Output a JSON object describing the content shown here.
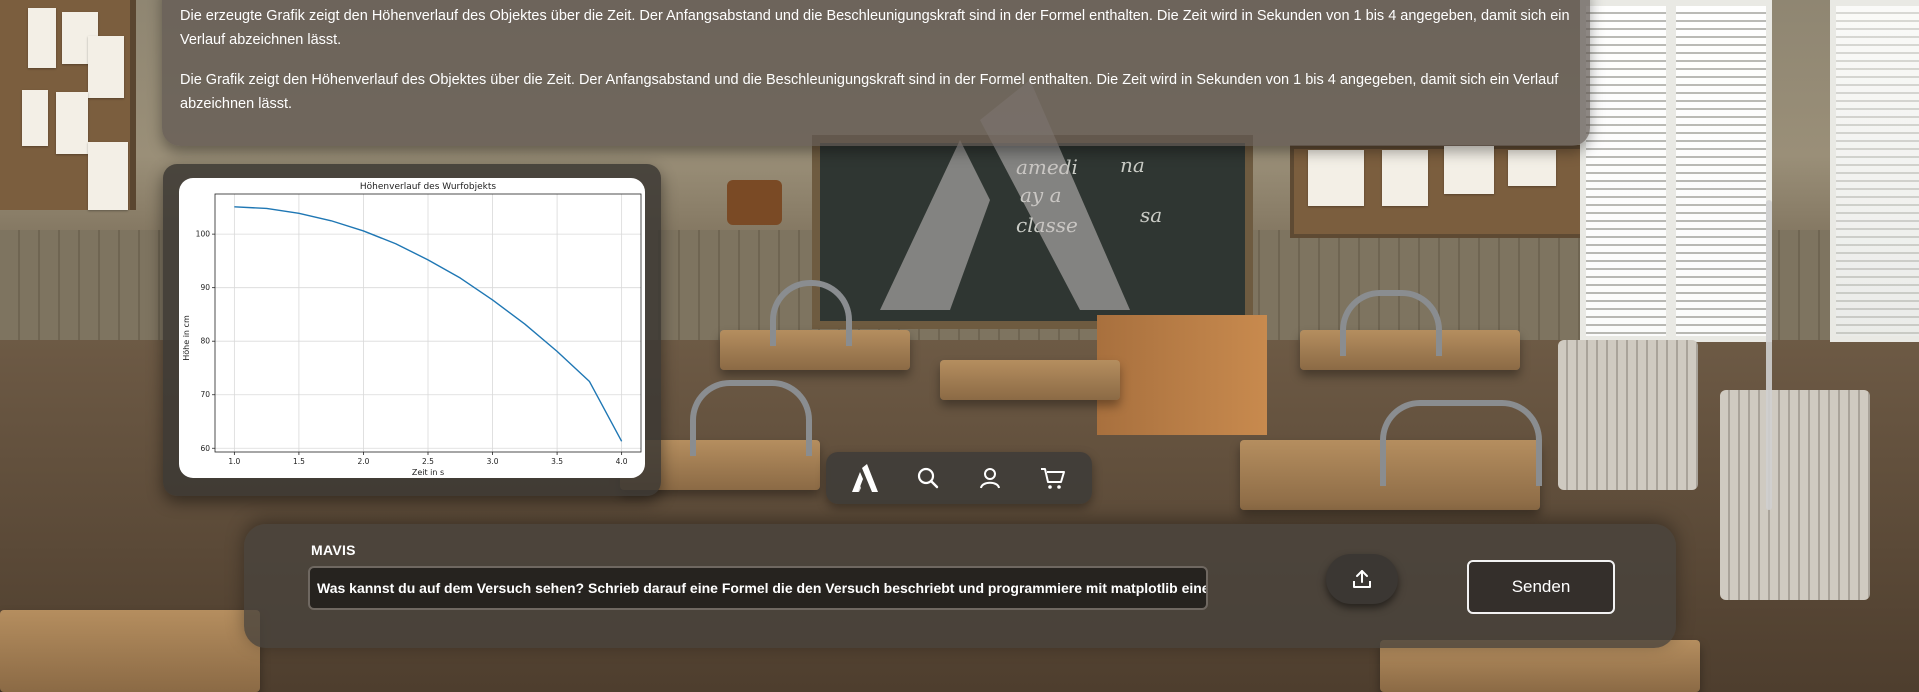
{
  "top_panel": {
    "paragraph_1": "Die erzeugte Grafik zeigt den Höhenverlauf des Objektes über die Zeit. Der Anfangsabstand und die Beschleunigungskraft sind in der Formel enthalten. Die Zeit wird in Sekunden von 1 bis 4 angegeben, damit sich ein Verlauf abzeichnen lässt.",
    "paragraph_2": "Die Grafik zeigt den Höhenverlauf des Objektes über die Zeit. Der Anfangsabstand und die Beschleunigungskraft sind in der Formel enthalten. Die Zeit wird in Sekunden von 1 bis 4 angegeben, damit sich ein Verlauf abzeichnen lässt."
  },
  "chart_data": {
    "type": "line",
    "title": "Höhenverlauf des Wurfobjekts",
    "xlabel": "Zeit in s",
    "ylabel": "Höhe in cm",
    "xlim": [
      0.85,
      4.15
    ],
    "ylim": [
      59.3,
      107.5
    ],
    "x_ticks": [
      "1.0",
      "1.5",
      "2.0",
      "2.5",
      "3.0",
      "3.5",
      "4.0"
    ],
    "y_ticks": [
      "60",
      "70",
      "80",
      "90",
      "100"
    ],
    "grid": true,
    "series": [
      {
        "color": "#1f77b4",
        "x": [
          1.0,
          1.25,
          1.5,
          1.75,
          2.0,
          2.25,
          2.5,
          2.75,
          3.0,
          3.25,
          3.5,
          3.75,
          4.0
        ],
        "y": [
          105.1,
          104.8,
          103.9,
          102.5,
          100.6,
          98.2,
          95.2,
          91.8,
          87.7,
          83.2,
          78.1,
          72.5,
          61.3
        ]
      }
    ]
  },
  "navbar": {
    "icons": [
      "logo-icon",
      "search-icon",
      "user-icon",
      "cart-icon"
    ]
  },
  "chat": {
    "label": "MAVIS",
    "input_value": "Was kannst du auf dem Versuch sehen? Schrieb darauf eine Formel die den Versuch beschriebt und programmiere mit matplotlib eine Grafik dazu in Pyth",
    "send_label": "Senden"
  },
  "colors": {
    "line": "#1f77b4",
    "panel": "#5f5852",
    "send_border": "#f2f2f2"
  }
}
